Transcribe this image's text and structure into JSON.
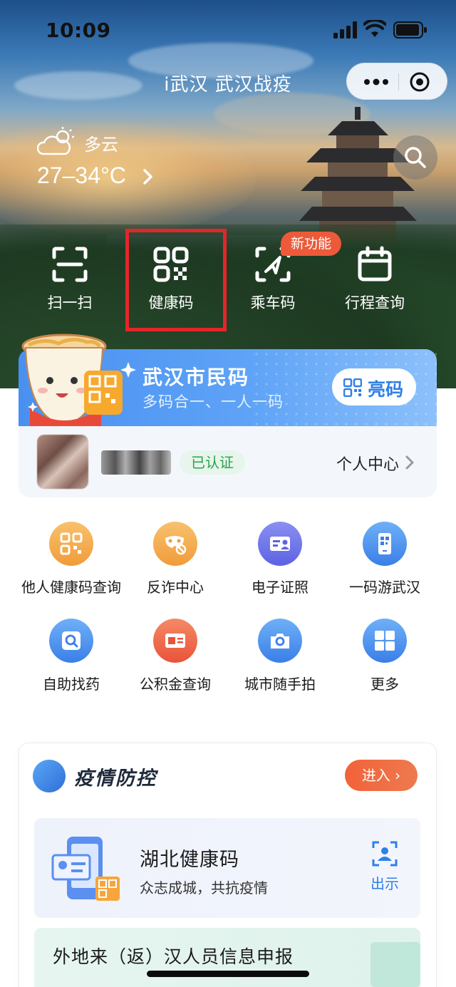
{
  "status_bar": {
    "time": "10:09"
  },
  "nav": {
    "title": "i武汉 武汉战疫"
  },
  "weather": {
    "condition": "多云",
    "temperature": "27–34°C"
  },
  "quick_actions": [
    {
      "label": "扫一扫",
      "icon": "scan-icon"
    },
    {
      "label": "健康码",
      "icon": "qr-code-icon"
    },
    {
      "label": "乘车码",
      "icon": "transit-code-icon"
    },
    {
      "label": "行程查询",
      "icon": "calendar-icon"
    }
  ],
  "new_feature_badge": "新功能",
  "citizen_card": {
    "title": "武汉市民码",
    "subtitle": "多码合一、一人一码",
    "show_button": "亮码",
    "verified": "已认证",
    "personal_center": "个人中心"
  },
  "services": [
    {
      "label": "他人健康码查询",
      "icon": "qr-code-icon",
      "color": "#f3a24a"
    },
    {
      "label": "反诈中心",
      "icon": "mask-icon",
      "color": "#f3a24a"
    },
    {
      "label": "电子证照",
      "icon": "id-card-icon",
      "color": "#6b74e8"
    },
    {
      "label": "一码游武汉",
      "icon": "phone-qr-icon",
      "color": "#4a90f0"
    },
    {
      "label": "自助找药",
      "icon": "search-icon",
      "color": "#4a90f0"
    },
    {
      "label": "公积金查询",
      "icon": "card-icon",
      "color": "#ee5a3a"
    },
    {
      "label": "城市随手拍",
      "icon": "camera-icon",
      "color": "#4a90f0"
    },
    {
      "label": "更多",
      "icon": "grid-icon",
      "color": "#4a90f0"
    }
  ],
  "epidemic": {
    "title": "疫情防控",
    "enter_button": "进入 ›",
    "health_card_title": "湖北健康码",
    "health_card_subtitle": "众志成城，共抗疫情",
    "show_label": "出示",
    "report_title": "外地来（返）汉人员信息申报"
  }
}
